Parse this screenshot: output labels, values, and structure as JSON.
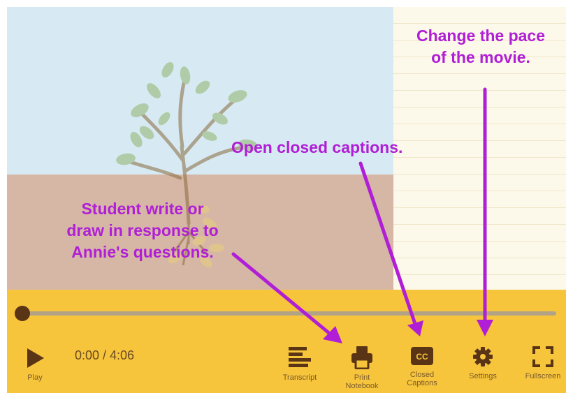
{
  "player": {
    "time_display": "0:00 / 4:06",
    "progress_fraction": 0.0
  },
  "controls": {
    "play_label": "Play",
    "transcript_label": "Transcript",
    "print_label_line1": "Print",
    "print_label_line2": "Notebook",
    "cc_label_line1": "Closed",
    "cc_label_line2": "Captions",
    "cc_icon_text": "CC",
    "settings_label": "Settings",
    "fullscreen_label": "Fullscreen"
  },
  "annotations": {
    "pace_line1": "Change the pace",
    "pace_line2": "of the movie.",
    "captions": "Open closed captions.",
    "student_line1": "Student write or",
    "student_line2": "draw in response to",
    "student_line3": "Annie's questions."
  },
  "colors": {
    "control_bar": "#f7c53c",
    "icon_brown": "#5a3515",
    "annotation_purple": "#b01ed6",
    "sky": "#d7eaf3",
    "soil": "#d6b7a6",
    "notebook": "#fdf9ea"
  },
  "icons": [
    "play-icon",
    "transcript-icon",
    "printer-icon",
    "closed-captions-icon",
    "gear-icon",
    "fullscreen-icon"
  ]
}
